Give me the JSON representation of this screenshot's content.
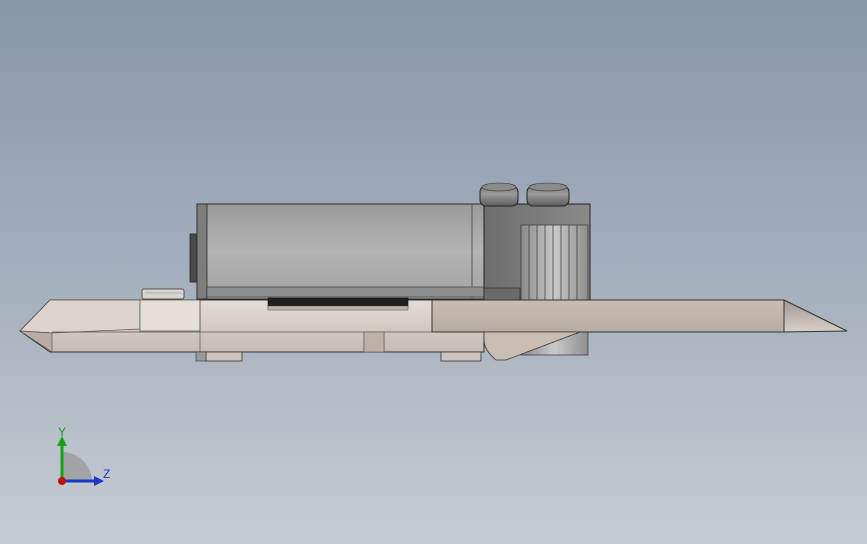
{
  "viewport": {
    "background_top": "#8796aa",
    "background_bottom": "#c6ccd3"
  },
  "model": {
    "name": "",
    "body_color": "#d3c8c0",
    "housing_color": "#a7a7a7",
    "fin_color": "#bdbdbd",
    "dark_strip_color": "#1f1f1f"
  },
  "triad": {
    "y_label": "Y",
    "z_label": "Z",
    "y_color": "#1aa01a",
    "z_color": "#1c35c8",
    "x_color": "#c01010"
  }
}
